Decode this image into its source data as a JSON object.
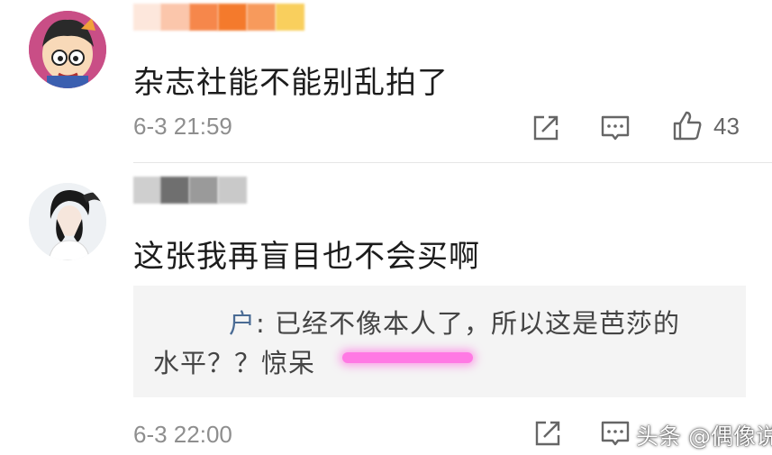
{
  "comments": [
    {
      "text": "杂志社能不能别乱拍了",
      "time": "6-3 21:59",
      "like_count": "43"
    },
    {
      "text": "这张我再盲目也不会买啊",
      "time": "6-3 22:00",
      "reply": {
        "user_suffix": "户",
        "line1": ": 已经不像本人了，所以这是芭莎的",
        "line2": "水平？？惊呆"
      }
    }
  ],
  "watermark": {
    "source": "头条",
    "account": "@偶像说"
  },
  "colors": {
    "blur_bar_1": [
      "#fde7dc",
      "#fbc6ab",
      "#f6874b",
      "#f47a2c",
      "#f79a5c",
      "#f9cf5d"
    ],
    "blur_bar_2": [
      "#cfcfcf",
      "#6f6f6f",
      "#9a9a9a",
      "#c9c9c9"
    ],
    "highlight_pink": "#ff79e4"
  }
}
